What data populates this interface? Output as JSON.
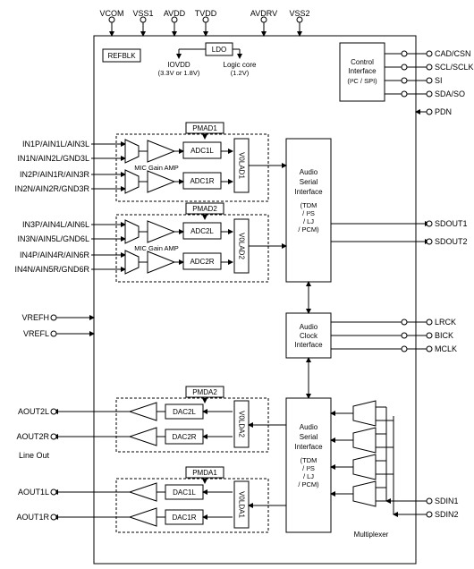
{
  "top_pins": {
    "vcom": "VCOM",
    "vss1": "VSS1",
    "avdd": "AVDD",
    "tvdd": "TVDD",
    "avdrv": "AVDRV",
    "vss2": "VSS2"
  },
  "top_blocks": {
    "refblk": "REFBLK",
    "ldo": "LDO",
    "iovdd": "IOVDD",
    "iovdd_note": "(3.3V or 1.8V)",
    "logiccore": "Logic core",
    "logiccore_note": "(1.2V)"
  },
  "control": {
    "title": "Control",
    "sub": "Interface",
    "note": "(I²C / SPI)"
  },
  "right_pins": {
    "cad": "CAD/CSN",
    "scl": "SCL/SCLK",
    "si": "SI",
    "sda": "SDA/SO",
    "pdn": "PDN",
    "sdout1": "SDOUT1",
    "sdout2": "SDOUT2",
    "lrck": "LRCK",
    "bick": "BICK",
    "mclk": "MCLK",
    "sdin1": "SDIN1",
    "sdin2": "SDIN2"
  },
  "left_pins": {
    "in1p": "IN1P/AIN1L/AIN3L",
    "in1n": "IN1N/AIN2L/GND3L",
    "in2p": "IN2P/AIN1R/AIN3R",
    "in2n": "IN2N/AIN2R/GND3R",
    "in3p": "IN3P/AIN4L/AIN6L",
    "in3n": "IN3N/AIN5L/GND6L",
    "in4p": "IN4P/AIN4R/AIN6R",
    "in4n": "IN4N/AIN5R/GND6R",
    "vrefh": "VREFH",
    "vrefl": "VREFL",
    "aout2l": "AOUT2L",
    "aout2r": "AOUT2R",
    "lineout": "Line Out",
    "aout1l": "AOUT1L",
    "aout1r": "AOUT1R"
  },
  "adc": {
    "pmad1": "PMAD1",
    "pmad2": "PMAD2",
    "mic": "MIC Gain AMP",
    "adc1l": "ADC1L",
    "adc1r": "ADC1R",
    "adc2l": "ADC2L",
    "adc2r": "ADC2R",
    "v0lad1": "V0LAD1",
    "v0lad2": "V0LAD2"
  },
  "asi": {
    "title": "Audio",
    "sub1": "Serial",
    "sub2": "Interface",
    "note1": "(TDM",
    "note2": "/ I²S",
    "note3": "/ LJ",
    "note4": "/ PCM)"
  },
  "clock": {
    "l1": "Audio",
    "l2": "Clock",
    "l3": "Interface"
  },
  "dac": {
    "pmda1": "PMDA1",
    "pmda2": "PMDA2",
    "dac1l": "DAC1L",
    "dac1r": "DAC1R",
    "dac2l": "DAC2L",
    "dac2r": "DAC2R",
    "v0lda1": "V0LDA1",
    "v0lda2": "V0LDA2"
  },
  "mux": "Multiplexer"
}
